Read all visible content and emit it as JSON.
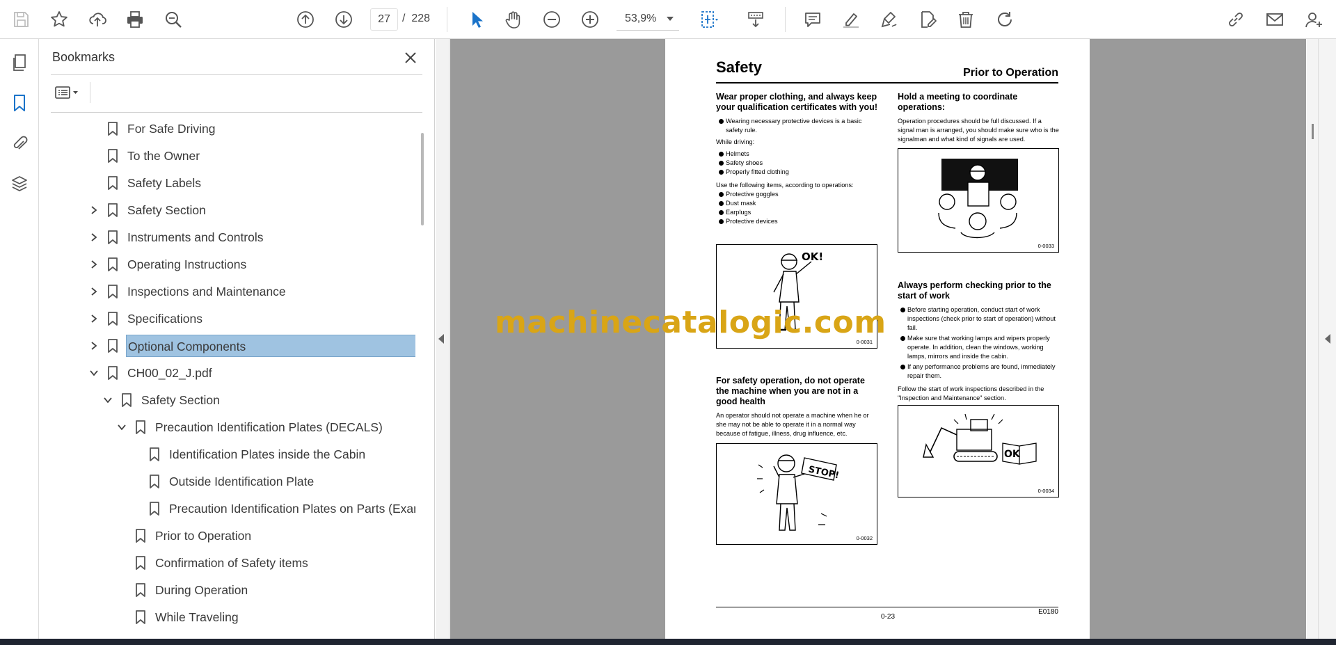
{
  "toolbar": {
    "page_current": "27",
    "page_total": "228",
    "zoom": "53,9%",
    "page_separator": "/"
  },
  "bookmarks": {
    "title": "Bookmarks",
    "items": [
      {
        "label": "For Safe Driving",
        "level": 0,
        "expander": "none",
        "selected": false
      },
      {
        "label": "To the Owner",
        "level": 0,
        "expander": "none",
        "selected": false
      },
      {
        "label": "Safety Labels",
        "level": 0,
        "expander": "none",
        "selected": false
      },
      {
        "label": "Safety Section",
        "level": 0,
        "expander": "collapsed",
        "selected": false
      },
      {
        "label": "Instruments and Controls",
        "level": 0,
        "expander": "collapsed",
        "selected": false
      },
      {
        "label": "Operating Instructions",
        "level": 0,
        "expander": "collapsed",
        "selected": false
      },
      {
        "label": "Inspections and Maintenance",
        "level": 0,
        "expander": "collapsed",
        "selected": false
      },
      {
        "label": "Specifications",
        "level": 0,
        "expander": "collapsed",
        "selected": false
      },
      {
        "label": "Optional Components",
        "level": 0,
        "expander": "collapsed",
        "selected": true
      },
      {
        "label": "CH00_02_J.pdf",
        "level": 0,
        "expander": "expanded",
        "selected": false
      },
      {
        "label": "Safety Section",
        "level": 1,
        "expander": "expanded",
        "selected": false
      },
      {
        "label": "Precaution Identification Plates (DECALS)",
        "level": 2,
        "expander": "expanded",
        "selected": false
      },
      {
        "label": "Identification Plates inside the Cabin",
        "level": 3,
        "expander": "none",
        "selected": false
      },
      {
        "label": "Outside Identification Plate",
        "level": 3,
        "expander": "none",
        "selected": false
      },
      {
        "label": "Precaution Identification Plates on Parts (Examples)",
        "level": 3,
        "expander": "none",
        "selected": false
      },
      {
        "label": "Prior to Operation",
        "level": 2,
        "expander": "none",
        "selected": false
      },
      {
        "label": "Confirmation of Safety items",
        "level": 2,
        "expander": "none",
        "selected": false
      },
      {
        "label": "During Operation",
        "level": 2,
        "expander": "none",
        "selected": false
      },
      {
        "label": "While Traveling",
        "level": 2,
        "expander": "none",
        "selected": false
      }
    ]
  },
  "page": {
    "title": "Safety",
    "section": "Prior to Operation",
    "left": {
      "block1_heading": "Wear proper clothing, and always keep your qualification certificates with you!",
      "block1_bullet": "Wearing necessary protective devices is a basic safety rule.",
      "while_driving": "While driving:",
      "driving_items": [
        "Helmets",
        "Safety shoes",
        "Properly fitted clothing"
      ],
      "use_following": "Use the following items, according to operations:",
      "operation_items": [
        "Protective goggles",
        "Dust mask",
        "Earplugs",
        "Protective devices"
      ],
      "fig1_code": "0-0031",
      "fig1_text": "OK!",
      "block2_heading": "For safety operation, do not operate the machine when you are not in a good health",
      "block2_text": "An operator should not operate a machine when he or she may not be able to operate it in a normal way because of fatigue, illness, drug influence, etc.",
      "fig2_code": "0-0032",
      "fig2_text": "STOP!"
    },
    "right": {
      "block1_heading": "Hold a meeting to coordinate operations:",
      "block1_text": "Operation procedures should be full discussed. If a signal man is arranged, you should make sure who is the signalman and what kind of signals are used.",
      "fig1_code": "0-0033",
      "block2_heading": "Always perform checking prior to the start of work",
      "block2_bullets": [
        "Before starting operation, conduct start of work inspections (check prior to start of operation) without fail.",
        "Make sure that working lamps and wipers properly operate. In addition, clean the windows, working lamps, mirrors and inside the cabin.",
        "If any performance problems are found, immediately repair them."
      ],
      "follow_text": "Follow the start of work inspections described in the \"Inspection and Maintenance\" section.",
      "fig2_code": "0-0034",
      "fig2_text": "OK"
    },
    "page_number": "0-23",
    "doc_code": "E0180"
  },
  "watermark": "machinecatalogic.com",
  "colors": {
    "accent_blue": "#1a73c9",
    "selection": "#9fc3e1",
    "doc_background": "#9a9a9a",
    "watermark": "#d9a516"
  },
  "icons": {
    "toolbar": [
      "save-icon",
      "star-icon",
      "upload-icon",
      "print-icon",
      "search-zoom-icon",
      "prev-page-icon",
      "next-page-icon",
      "select-cursor-icon",
      "hand-icon",
      "zoom-out-icon",
      "zoom-in-icon",
      "fit-page-icon",
      "scroll-mode-icon",
      "comment-icon",
      "highlight-icon",
      "draw-icon",
      "fill-sign-icon",
      "delete-icon",
      "rotate-icon",
      "share-link-icon",
      "email-icon",
      "account-icon"
    ],
    "rail": [
      "pages-icon",
      "bookmark-icon",
      "attachment-icon",
      "layers-icon"
    ]
  }
}
